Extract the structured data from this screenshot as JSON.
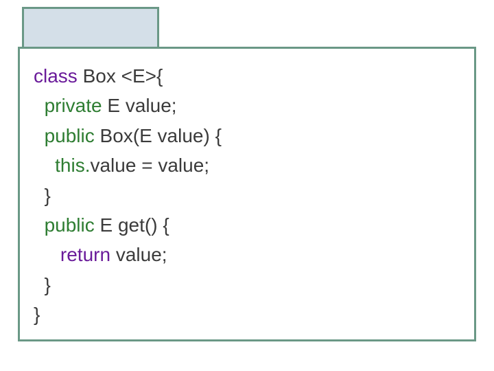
{
  "code": {
    "tokens": {
      "class": "class",
      "private": "private",
      "public": "public",
      "this": "this.",
      "return": "return"
    },
    "lines": {
      "l1_after": " Box <E>{",
      "l2_after": " E value;",
      "l3_after": " Box(E value) {",
      "l4_after": "value = value;",
      "l5": "  }",
      "l6_after": " E get() {",
      "l7_after": " value;",
      "l8": "  }",
      "l9": "}"
    }
  },
  "colors": {
    "border": "#6a9886",
    "title_bg": "#d4dfe8",
    "text": "#3b3b3b",
    "keyword_purple": "#6a1b9a",
    "keyword_green": "#2e7d32"
  }
}
